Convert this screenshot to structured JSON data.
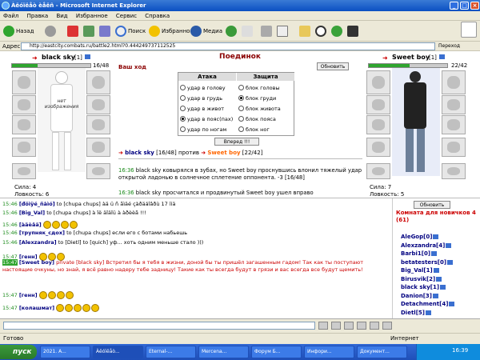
{
  "window": {
    "title": "Àëóïëåò èåëñ - Microsoft Internet Explorer"
  },
  "menu": [
    "Файл",
    "Правка",
    "Вид",
    "Избранное",
    "Сервис",
    "Справка"
  ],
  "toolbar": {
    "back": "Назад",
    "search": "Поиск",
    "favorites": "Избранное",
    "media": "Медиа"
  },
  "address": {
    "label": "Адрес:",
    "url": "http://eastcity.combats.ru/battle2.html?0.444249737112525",
    "go": "Переход"
  },
  "battle": {
    "title": "Поединок",
    "your_move": "Ваш ход",
    "refresh": "Обновить",
    "attack_header": "Атака",
    "defense_header": "Защита",
    "attacks": [
      "удар в голову",
      "удар в грудь",
      "удар в живот",
      "удар в пояс(пах)",
      "удар по ногам"
    ],
    "defenses": [
      "блок головы",
      "блок груди",
      "блок живота",
      "блок пояса",
      "блок ног"
    ],
    "selected_attack": 3,
    "selected_defense": 1,
    "forward": "Вперед !!!",
    "versus": {
      "p1": "black sky",
      "p1hp": "[16/48]",
      "word": "против",
      "p2": "Sweet boy",
      "p2hp": "[22/42]"
    },
    "log": [
      {
        "time": "16:36",
        "text": "black sky ковырялся в зубах, но Sweet boy проснувшись влонил тяжелый удар открытой ладонью в солнечное сплетение оппонента. -3 [16/48]"
      },
      {
        "time": "16:36",
        "text": "black sky просчитался и продвинутый Sweet boy ушел вправо"
      }
    ]
  },
  "player1": {
    "name": "black sky",
    "level": "[1]",
    "hp": "16/48",
    "hp_fraction": 0.33,
    "no_image": "нет изображения",
    "strength": "Сила: 4",
    "agility": "Ловкость: 6"
  },
  "player2": {
    "name": "Sweet boy",
    "level": "[1]",
    "hp": "22/42",
    "hp_fraction": 0.52,
    "strength": "Сила: 7",
    "agility": "Ловкость: 5"
  },
  "chat": [
    {
      "time": "15:46",
      "nick": "[đöìÿé_ñàìó]",
      "text": "to [chupa chups] àä ü ñ ãìäé çàðäáîâðù 17 ììä"
    },
    {
      "time": "15:46",
      "nick": "[Big_Val]",
      "text": "to [chupa chups] à îë äîäîü à àðèèã !!!"
    },
    {
      "time": "15:46",
      "nick": "[àäèâä]",
      "text": ""
    },
    {
      "time": "15:46",
      "nick": "[трупняк_сдох]",
      "text": "to [chupa chups] если его с ботами набьешь"
    },
    {
      "time": "15:46",
      "nick": "[Alexzandra]",
      "text": "to [Dietl] to [quich] уф... хоть одним меньше стало )))"
    },
    {
      "time": "15:47",
      "nick": "[генн]",
      "text": ""
    },
    {
      "time": "15:47",
      "nick": "[Sweet boy]",
      "text": "private [black sky] Встретил бы я тебя в жизни, доной бы ты пришёл загашенным гадом! Так как ты поступают настоящие очкуны, но знай, я всё равно надеру тебе задницу! Такие как ты всегда будут в грязи и вас всегда все будут щемить!"
    },
    {
      "time": "15:47",
      "nick": "[генн]",
      "text": ""
    },
    {
      "time": "15:47",
      "nick": "[колашмат]",
      "text": ""
    }
  ],
  "room": {
    "refresh": "Обновить",
    "title": "Комната для новичков 4 (61)",
    "users": [
      "AleGop[0]",
      "Alexzandra[4]",
      "Barbi1[0]",
      "betatesters[0]",
      "Big_Val[1]",
      "Birusvik[2]",
      "black sky[1]",
      "Danion[3]",
      "Detachment[4]",
      "Dietl[5]"
    ]
  },
  "status": {
    "left": "Готово",
    "zone": "Интернет"
  },
  "taskbar": {
    "start": "пуск",
    "tasks": [
      "2021. A...",
      "Àëóïëåò...",
      "Eternal-...",
      "Mercena...",
      "Форум Б...",
      "Инфори...",
      "Документ..."
    ],
    "clock": "16:39"
  },
  "colors": {
    "xp_blue": "#0a4fc2",
    "title_red": "#8b0000",
    "nick_blue": "#000080",
    "time_green": "#1a8a1a",
    "orange": "#ff6600"
  }
}
